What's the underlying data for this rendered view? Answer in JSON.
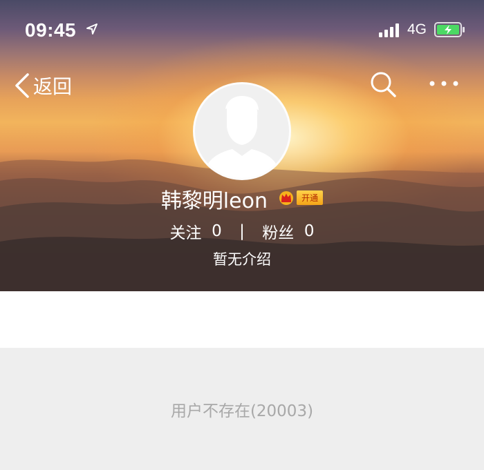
{
  "status_bar": {
    "time": "09:45",
    "network": "4G"
  },
  "nav": {
    "back_label": "返回"
  },
  "profile": {
    "username": "韩黎明leon",
    "vip_badge": "开通",
    "following_label": "关注",
    "following_count": "0",
    "separator": "|",
    "followers_label": "粉丝",
    "followers_count": "0",
    "bio": "暂无介绍"
  },
  "content": {
    "error_message": "用户不存在(20003)"
  }
}
